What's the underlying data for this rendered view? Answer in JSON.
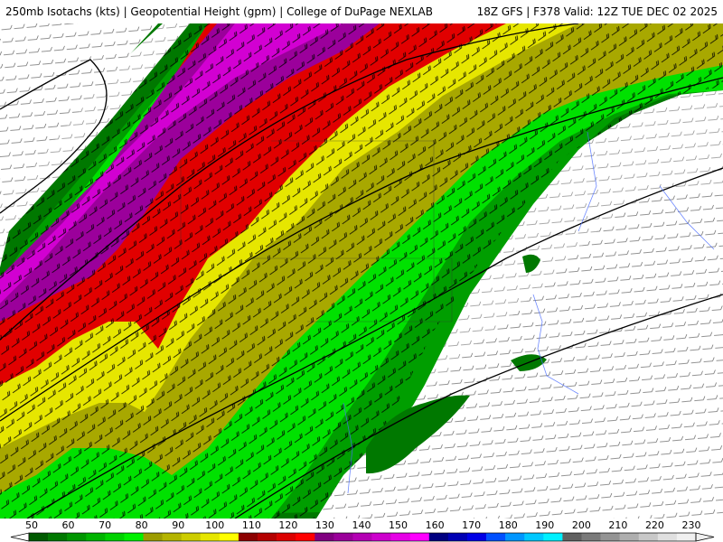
{
  "header": {
    "left_title": "250mb Isotachs (kts) | Geopotential Height (gpm) | College of DuPage NEXLAB",
    "right_title": "18Z GFS | F378 Valid: 12Z TUE DEC 02 2025"
  },
  "legend": {
    "labels": [
      "50",
      "60",
      "70",
      "80",
      "90",
      "100",
      "110",
      "120",
      "130",
      "140",
      "150",
      "160",
      "170",
      "180",
      "190",
      "200",
      "210",
      "220",
      "230"
    ],
    "colors": [
      "#005a00",
      "#007800",
      "#009600",
      "#00b400",
      "#00d200",
      "#00f000",
      "#9c9c00",
      "#b4b400",
      "#cdcd00",
      "#e6e600",
      "#ffff00",
      "#8b0000",
      "#b40000",
      "#dc0000",
      "#ff0000",
      "#800080",
      "#9a009a",
      "#b400b4",
      "#cd00cd",
      "#e600e6",
      "#ff00ff",
      "#000080",
      "#0000b4",
      "#0000e6",
      "#0050ff",
      "#0096ff",
      "#00c8ff",
      "#00f0ff",
      "#606060",
      "#7a7a7a",
      "#949494",
      "#aeaeae",
      "#c8c8c8",
      "#e0e0e0",
      "#f0f0f0"
    ]
  },
  "map": {
    "colors": {
      "green_dark": "#007800",
      "green_mid": "#009e00",
      "green_bright": "#00e100",
      "olive": "#a8a800",
      "yellow": "#e6e600",
      "red": "#e10000",
      "purple": "#9b009b",
      "magenta": "#d200d2",
      "water_lines": "#4a6cff",
      "barbs": "#000000"
    }
  }
}
